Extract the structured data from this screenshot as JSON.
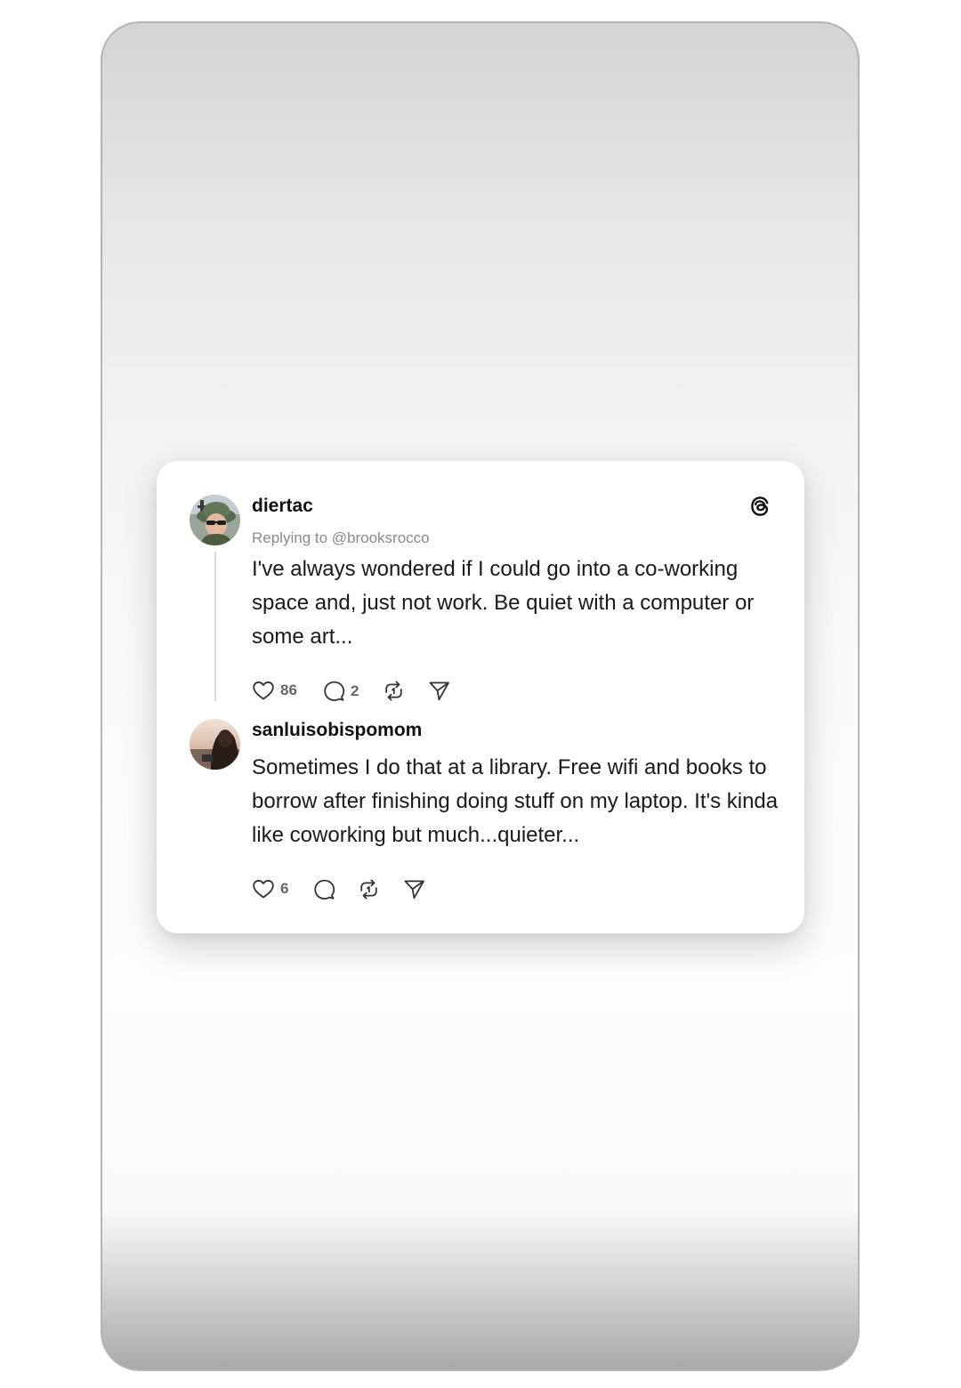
{
  "post": {
    "username": "diertac",
    "replying_to": "Replying to @brooksrocco",
    "text": "I've always wondered if I could go into a co-working space and, just not work. Be quiet with a computer or some art...",
    "likes": "86",
    "replies": "2"
  },
  "reply": {
    "username": "sanluisobispomom",
    "text": "Sometimes I do that at a library. Free wifi and books to borrow after finishing doing stuff on my laptop. It's kinda like coworking but much...quieter...",
    "likes": "6"
  },
  "icons": {
    "brand": "threads-logo-icon",
    "like": "heart-icon",
    "reply": "speech-bubble-icon",
    "repost": "repost-icon",
    "share": "send-icon"
  },
  "colors": {
    "text": "#111111",
    "muted": "#8a8a8a",
    "icon": "#333333"
  }
}
